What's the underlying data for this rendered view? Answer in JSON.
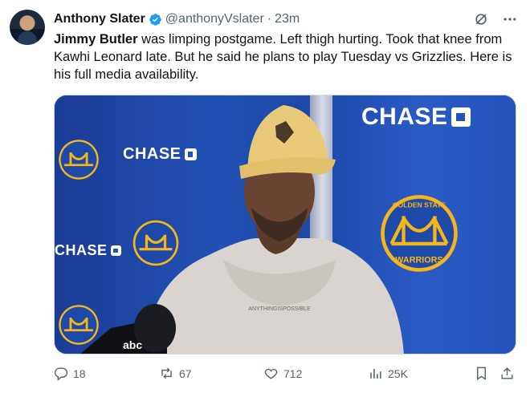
{
  "tweet": {
    "author_name": "Anthony Slater",
    "handle": "@anthonyVslater",
    "separator": "·",
    "time": "23m",
    "text_bold": "Jimmy Butler",
    "text_rest": " was limping postgame. Left thigh hurting. Took that knee from Kawhi Leonard late. But he said he plans to play Tuesday vs Grizzlies. Here is his full media availability.",
    "icons": {
      "verified": "verified-badge-icon",
      "grok": "grok-icon",
      "more": "more-icon"
    },
    "colors": {
      "verified": "#1d9bf0",
      "text": "#0f1419",
      "secondary": "#536471"
    }
  },
  "media": {
    "sponsor_text": "CHASE",
    "team_text_top": "GOLDEN STATE",
    "team_text_bottom": "WARRIORS",
    "hoodie_text": "ANYTHINGISPOSSIBLE",
    "mic_text": "abc"
  },
  "actions": {
    "reply_count": "18",
    "repost_count": "67",
    "like_count": "712",
    "views_count": "25K"
  }
}
